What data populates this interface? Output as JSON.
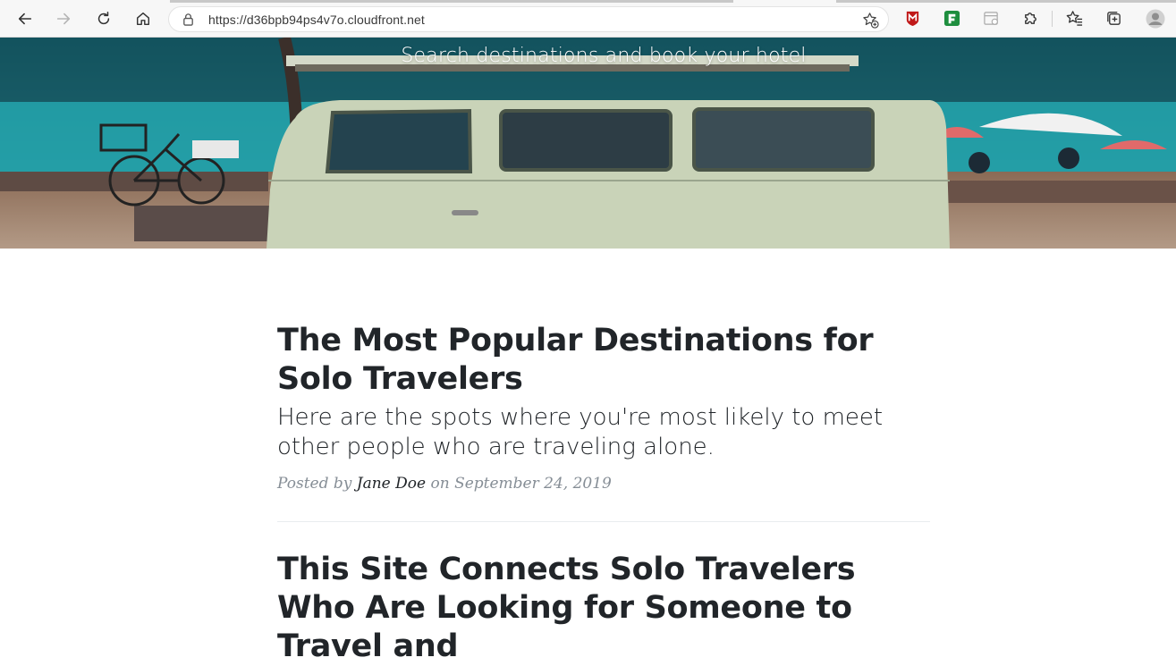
{
  "browser": {
    "url": "https://d36bpb94ps4v7o.cloudfront.net",
    "icons": {
      "back": "arrow-left-icon",
      "forward": "arrow-right-icon",
      "refresh": "refresh-icon",
      "home": "home-icon",
      "lock": "lock-icon",
      "favorite": "star-add-icon",
      "extensions": [
        "mcafee-icon",
        "green-extension-icon",
        "reader-icon",
        "puzzle-icon"
      ],
      "favorites_list": "favorites-icon",
      "collections": "collections-icon",
      "profile": "avatar-icon"
    }
  },
  "hero": {
    "subtitle": "Search destinations and book your hotel"
  },
  "posts": [
    {
      "title": "The Most Popular Destinations for Solo Travelers",
      "subtitle": "Here are the spots where you're most likely to meet other people who are traveling alone.",
      "meta_prefix": "Posted by",
      "author": "Jane Doe",
      "meta_on": "on",
      "date": "September 24, 2019"
    },
    {
      "title": "This Site Connects Solo Travelers Who Are Looking for Someone to Travel and"
    }
  ],
  "colors": {
    "text": "#212529",
    "muted": "#868e96",
    "sea": "#2f8f96",
    "van": "#c9d3b8"
  }
}
